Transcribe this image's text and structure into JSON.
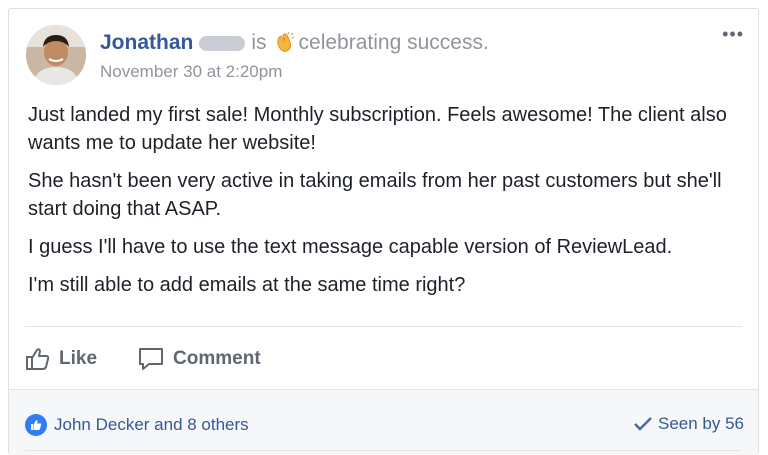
{
  "post": {
    "author": "Jonathan",
    "verb": "is",
    "activity": "celebrating success.",
    "timestamp": "November 30 at 2:20pm",
    "more_label": "•••",
    "paragraphs": [
      "Just landed my first sale! Monthly subscription. Feels awesome! The client also wants me to update her website!",
      "She hasn't been very active in taking emails from her past customers but she'll start doing that ASAP.",
      "I guess I'll have to use the text message capable version of ReviewLead.",
      "I'm still able to add emails at the same time right?"
    ]
  },
  "actions": {
    "like_label": "Like",
    "comment_label": "Comment"
  },
  "footer": {
    "reactors": "John Decker and 8 others",
    "seen": "Seen by 56"
  },
  "colors": {
    "link": "#365899",
    "muted": "#90949c",
    "like_blue": "#2e7cf6"
  },
  "icons": {
    "avatar": "avatar",
    "clap": "clapping-hands-icon",
    "like": "thumbs-up-icon",
    "comment": "comment-bubble-icon",
    "seen": "checkmark-icon"
  }
}
